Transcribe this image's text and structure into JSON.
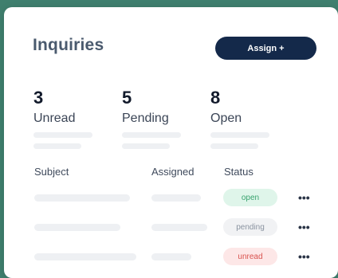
{
  "header": {
    "title": "Inquiries",
    "assign_label": "Assign +"
  },
  "stats": [
    {
      "value": "3",
      "label": "Unread"
    },
    {
      "value": "5",
      "label": "Pending"
    },
    {
      "value": "8",
      "label": "Open"
    }
  ],
  "table": {
    "columns": [
      "Subject",
      "Assigned",
      "Status"
    ],
    "rows": [
      {
        "status": "open",
        "status_color": "#dff5ea",
        "status_text_color": "#3aa36f"
      },
      {
        "status": "pending",
        "status_color": "#f1f2f4",
        "status_text_color": "#8a93a0"
      },
      {
        "status": "unread",
        "status_color": "#fde7e7",
        "status_text_color": "#d9534f"
      }
    ],
    "more_glyph": "•••"
  },
  "colors": {
    "background": "#3f7f6e",
    "button": "#14294a"
  }
}
